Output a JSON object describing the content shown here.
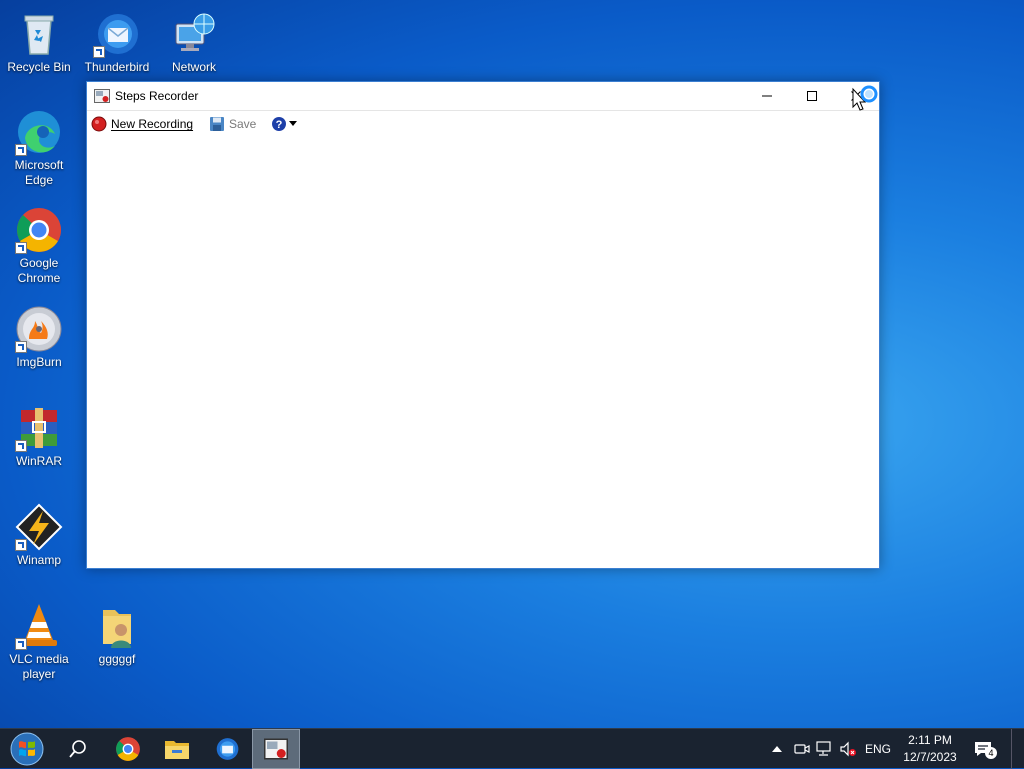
{
  "desktop": {
    "icons": [
      {
        "label": "Recycle Bin"
      },
      {
        "label": "Thunderbird"
      },
      {
        "label": "Network"
      },
      {
        "label": "Microsoft Edge"
      },
      {
        "label": "Google Chrome"
      },
      {
        "label": "ImgBurn"
      },
      {
        "label": "WinRAR"
      },
      {
        "label": "Winamp"
      },
      {
        "label": "VLC media player"
      },
      {
        "label": "gggggf"
      }
    ]
  },
  "window": {
    "title": "Steps Recorder",
    "toolbar": {
      "new_recording_label": "New Recording",
      "save_label": "Save"
    }
  },
  "taskbar": {
    "language": "ENG",
    "time": "2:11 PM",
    "date": "12/7/2023",
    "notification_count": "4"
  },
  "colors": {
    "record_red": "#d32020",
    "accent_blue": "#0a5bc8",
    "taskbar_bg": "#1a2330"
  }
}
